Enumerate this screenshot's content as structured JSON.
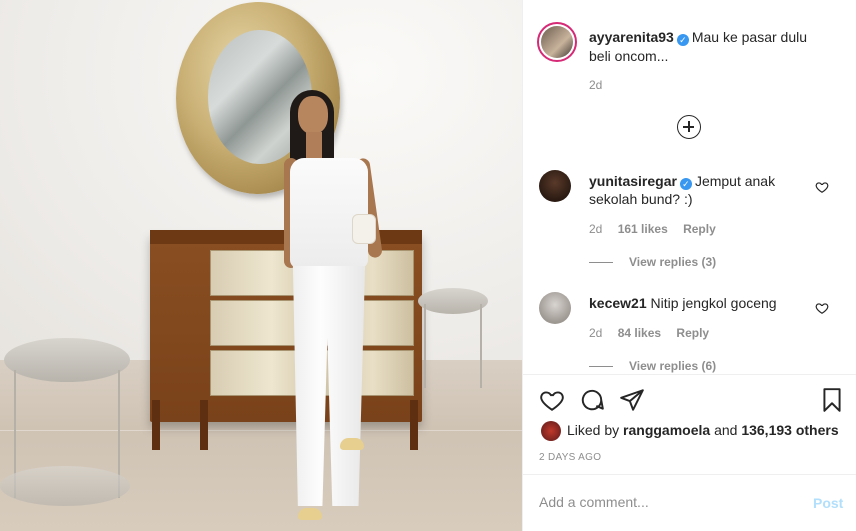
{
  "post": {
    "username": "ayyarenita93",
    "caption": "Mau ke pasar dulu beli oncom...",
    "time": "2d"
  },
  "comments": [
    {
      "username": "yunitasiregar",
      "verified": true,
      "text": "Jemput anak sekolah bund? :)",
      "time": "2d",
      "likes": "161 likes",
      "reply": "Reply",
      "view_replies": "View replies (3)"
    },
    {
      "username": "kecew21",
      "verified": false,
      "text": "Nitip jengkol goceng",
      "time": "2d",
      "likes": "84 likes",
      "reply": "Reply",
      "view_replies": "View replies (6)"
    }
  ],
  "likes_summary": {
    "prefix": "Liked by",
    "user": "ranggamoela",
    "middle": "and",
    "others": "136,193 others"
  },
  "posted_ago": "2 DAYS AGO",
  "add_comment": {
    "placeholder": "Add a comment...",
    "post_label": "Post"
  },
  "colors": {
    "verified": "#3897f0",
    "post_button_disabled": "#b2dffc",
    "muted_text": "#8e8e8e",
    "story_ring": "#d62976"
  },
  "icons": [
    "add-circle-icon",
    "heart-icon",
    "comment-icon",
    "share-icon",
    "bookmark-icon",
    "verified-badge-icon"
  ]
}
